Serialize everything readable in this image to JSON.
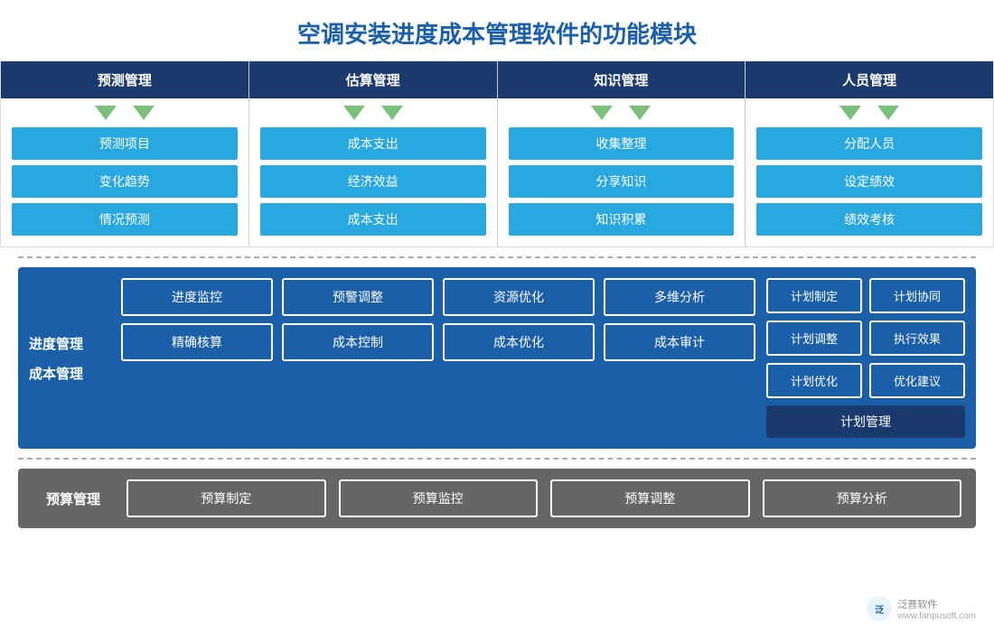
{
  "title": "空调安装进度成本管理软件的功能模块",
  "topColumns": [
    {
      "header": "预测管理",
      "arrows": 2,
      "items": [
        "预测项目",
        "变化趋势",
        "情况预测"
      ]
    },
    {
      "header": "估算管理",
      "arrows": 2,
      "items": [
        "成本支出",
        "经济效益",
        "成本支出"
      ]
    },
    {
      "header": "知识管理",
      "arrows": 2,
      "items": [
        "收集整理",
        "分享知识",
        "知识积累"
      ]
    },
    {
      "header": "人员管理",
      "arrows": 2,
      "items": [
        "分配人员",
        "设定绩效",
        "绩效考核"
      ]
    }
  ],
  "middleSection": {
    "labels": [
      "进度管理",
      "成本管理"
    ],
    "row1": [
      "进度监控",
      "预警调整",
      "资源优化",
      "多维分析"
    ],
    "row2": [
      "精确核算",
      "成本控制",
      "成本优化",
      "成本审计"
    ],
    "rightGrid": [
      "计划制定",
      "计划协同",
      "计划调整",
      "执行效果",
      "计划优化",
      "优化建议"
    ],
    "rightFooter": "计划管理"
  },
  "bottomSection": {
    "label": "预算管理",
    "items": [
      "预算制定",
      "预算监控",
      "预算调整",
      "预算分析"
    ]
  },
  "watermark": {
    "logo": "泛",
    "name": "泛普软件",
    "url": "www.fanpusoft.com"
  }
}
